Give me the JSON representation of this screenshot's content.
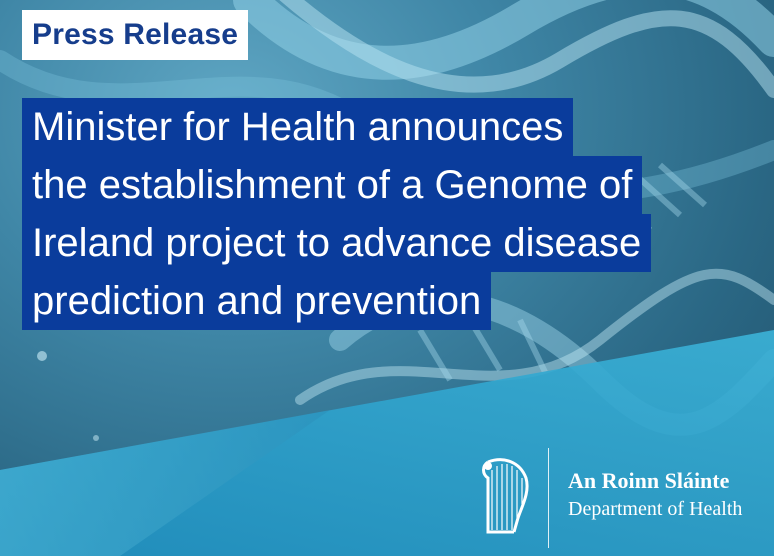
{
  "press_label": "Press Release",
  "headline": {
    "lines": [
      "Minister for Health announces",
      "the establishment of a Genome of",
      "Ireland project to advance disease",
      "prediction and prevention"
    ]
  },
  "department": {
    "name_irish": "An Roinn Sláinte",
    "name_english": "Department of Health"
  },
  "colors": {
    "headline_bg": "#0a3c9c",
    "label_text": "#163d8c",
    "background": "#3f86a6",
    "wedge": "#1f8fbf"
  },
  "icons": [
    "dna-helix-background",
    "harp-icon"
  ]
}
